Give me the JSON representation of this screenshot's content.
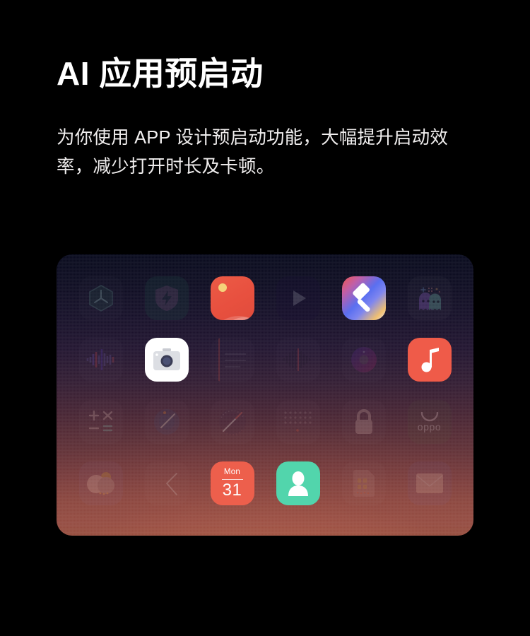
{
  "heading": {
    "title": "AI 应用预启动",
    "subtitle": "为你使用 APP 设计预启动功能，大幅提升启动效率，减少打开时长及卡顿。"
  },
  "colors": {
    "background": "#000000",
    "title_text": "#ffffff",
    "subtitle_text": "#f0eeee",
    "panel_top": "#080a1d",
    "panel_bottom": "#96503f",
    "accent_red": "#ef5b49",
    "accent_green": "#52d5ac",
    "highlight_white": "#ffffff"
  },
  "panel": {
    "label": "app-grid-panel",
    "rows": 4,
    "columns": 6,
    "apps": [
      {
        "name": "theme-hexagon-app",
        "icon": "hexagon-fan-icon",
        "state": "dimmed",
        "tile": "t-transparent"
      },
      {
        "name": "security-app",
        "icon": "shield-bolt-icon",
        "state": "dimmed",
        "tile": "t-darkteal"
      },
      {
        "name": "gallery-app",
        "icon": "photos-sun-icon",
        "state": "active",
        "tile": "t-gallery"
      },
      {
        "name": "video-player-app",
        "icon": "play-triangle-icon",
        "state": "dimmed",
        "tile": "t-video"
      },
      {
        "name": "themes-app",
        "icon": "paint-roller-icon",
        "state": "active",
        "tile": "t-theme"
      },
      {
        "name": "game-center-app",
        "icon": "ghosts-icon",
        "state": "dimmed",
        "tile": "t-ghost"
      },
      {
        "name": "soundbar-app",
        "icon": "waveform-bars-icon",
        "state": "dimmed",
        "tile": "t-transparent"
      },
      {
        "name": "camera-app",
        "icon": "camera-icon",
        "state": "active",
        "tile": "t-white"
      },
      {
        "name": "notes-app",
        "icon": "lined-notebook-icon",
        "state": "dimmed",
        "tile": "t-transparent"
      },
      {
        "name": "recorder-app",
        "icon": "voice-waveform-icon",
        "state": "dimmed",
        "tile": "t-transparent"
      },
      {
        "name": "disc-player-app",
        "icon": "vinyl-record-icon",
        "state": "dimmed",
        "tile": "t-transparent"
      },
      {
        "name": "music-app",
        "icon": "music-note-icon",
        "state": "active",
        "tile": "t-music"
      },
      {
        "name": "calculator-app",
        "icon": "plus-minus-times-equals-icon",
        "state": "dimmed",
        "tile": "t-transparent"
      },
      {
        "name": "compass-app",
        "icon": "compass-dial-icon",
        "state": "dimmed",
        "tile": "t-transparent"
      },
      {
        "name": "gauge-app",
        "icon": "speedometer-needle-icon",
        "state": "dimmed",
        "tile": "t-transparent"
      },
      {
        "name": "dot-grid-app",
        "icon": "dot-matrix-icon",
        "state": "dimmed",
        "tile": "t-transparent"
      },
      {
        "name": "private-safe-app",
        "icon": "padlock-icon",
        "state": "dimmed",
        "tile": "t-transparent"
      },
      {
        "name": "app-market-app",
        "icon": "oppo-shopping-bag-icon",
        "state": "dimmed",
        "tile": "t-oppo",
        "text": "oppo"
      },
      {
        "name": "weather-app",
        "icon": "cloud-fruit-icon",
        "state": "dimmed",
        "tile": "t-plum"
      },
      {
        "name": "clock-app",
        "icon": "clock-hands-icon",
        "state": "dimmed",
        "tile": "t-transparent"
      },
      {
        "name": "calendar-app",
        "icon": "calendar-icon",
        "state": "active",
        "tile": "t-calendar",
        "dow": "Mon",
        "day": "31"
      },
      {
        "name": "contacts-app",
        "icon": "person-silhouette-icon",
        "state": "active",
        "tile": "t-contacts"
      },
      {
        "name": "sim-toolkit-app",
        "icon": "sim-card-icon",
        "state": "dimmed",
        "tile": "t-transparent"
      },
      {
        "name": "mail-app",
        "icon": "envelope-icon",
        "state": "dimmed",
        "tile": "t-mail"
      }
    ]
  }
}
